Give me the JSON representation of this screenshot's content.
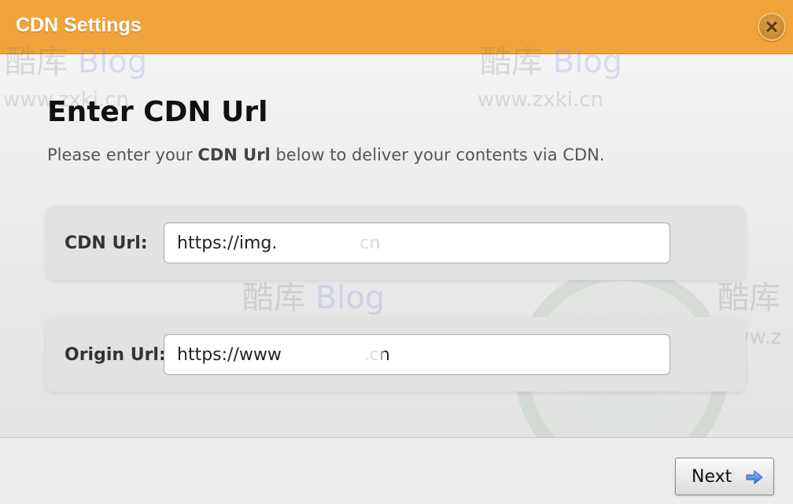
{
  "dialog": {
    "title": "CDN Settings",
    "close_icon": "close-icon"
  },
  "main": {
    "heading": "Enter CDN Url",
    "subtitle_pre": "Please enter your ",
    "subtitle_bold": "CDN Url",
    "subtitle_post": " below to deliver your contents via CDN."
  },
  "fields": {
    "cdn_url": {
      "label": "CDN Url:",
      "value": "https://img.               cn"
    },
    "origin_url": {
      "label": "Origin Url:",
      "value": "https://www               .cn"
    }
  },
  "footer": {
    "next_label": "Next",
    "next_icon": "arrow-right-icon"
  },
  "watermark": {
    "brand_cn": "酷库",
    "brand_en": "Blog",
    "url": "www.zxki.cn",
    "brand_cn_partial": "酷库",
    "url_partial": "www.z"
  },
  "colors": {
    "titlebar": "#f2a43c",
    "close_button": "#c98a2e",
    "arrow": "#3a7be0"
  }
}
